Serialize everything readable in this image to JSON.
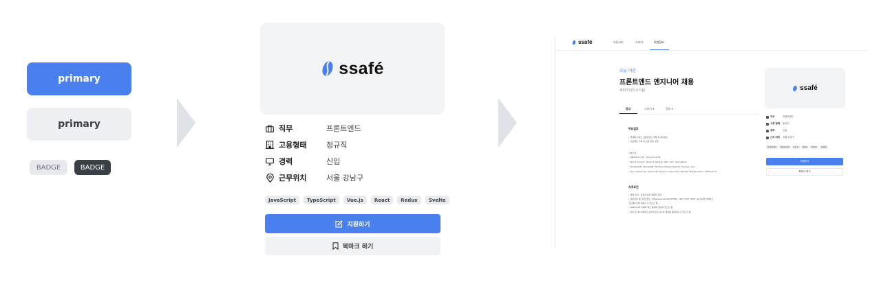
{
  "samples": {
    "primary_button": "primary",
    "secondary_button": "primary",
    "badge_light": "BADGE",
    "badge_dark": "BADGE"
  },
  "brand": {
    "logo_text": "ssafé",
    "color": "#4a80ee"
  },
  "card": {
    "rows": [
      {
        "icon": "briefcase-icon",
        "label": "직무",
        "value": "프론트엔드"
      },
      {
        "icon": "building-icon",
        "label": "고용형태",
        "value": "정규직"
      },
      {
        "icon": "monitor-icon",
        "label": "경력",
        "value": "신입"
      },
      {
        "icon": "location-pin-icon",
        "label": "근무위치",
        "value": "서울 강남구"
      }
    ],
    "tags": [
      "JavaScript",
      "TypeScript",
      "Vue.js",
      "React",
      "Redux",
      "Svelte"
    ],
    "apply_label": "지원하기",
    "bookmark_label": "북마크 하기"
  },
  "preview": {
    "nav": {
      "logo": "ssafé",
      "tabs": [
        "커뮤니티",
        "스터디",
        "취업정보"
      ]
    },
    "deadline": "오늘 마감",
    "title": "프론트엔드 엔지니어 채용",
    "company": "싸피아이티시스템",
    "subtabs": [
      "공고",
      "스터디 ▾",
      "정보 ▾"
    ],
    "sections": [
      {
        "title": "주요업무",
        "lines": [
          "• 플랫폼 서비스 프론트엔드 개발 및 유지보수",
          "• 프로젝트 기획 및 신규 업무 수행"
        ]
      },
      {
        "title": "기술스택",
        "lines": [
          "• AWS EC2 / S3 , Ubuntu 20.04,",
          "• Nginx, Docker, Node.JS, Nest.JS, PM2, Yarn, SpringBoot",
          "• PostgreSQL, MongoDB, ELK Stack(ElasticSearch), Express, Koa",
          "• Java, Javascript, Typescript, Styled-components, ReactJS, NextJS, Redux, Material-UI"
        ]
      },
      {
        "title": "자격요건",
        "lines": [
          "• 경력 무관 · 포지션 관련 경험자 우대",
          "• 일반적인 웹 프론트엔드 기술(Javascript/CSS/HTML, CSS, HTTP, REST API 등)을 이해하고",
          "  코드베이스에 적용할 수 있으신 분",
          "• React.js의 이해와 최신 동향에 관심이 있으신 분",
          "• 비즈니스를 이해하고 논리적으로 UI/UX 개선에 참여하실 수 있으신 분"
        ]
      }
    ],
    "side": {
      "logo": "ssafé",
      "rows": [
        {
          "label": "직무",
          "value": "프론트엔드"
        },
        {
          "label": "고용 형태",
          "value": "정규직"
        },
        {
          "label": "경력",
          "value": "신입"
        },
        {
          "label": "근무 위치",
          "value": "서울 강남구"
        }
      ],
      "tags": [
        "JavaScript",
        "TypeScript",
        "Vue.js",
        "React",
        "Redux",
        "Svelte"
      ],
      "apply_label": "지원하기",
      "bookmark_label": "북마크 하기"
    }
  }
}
